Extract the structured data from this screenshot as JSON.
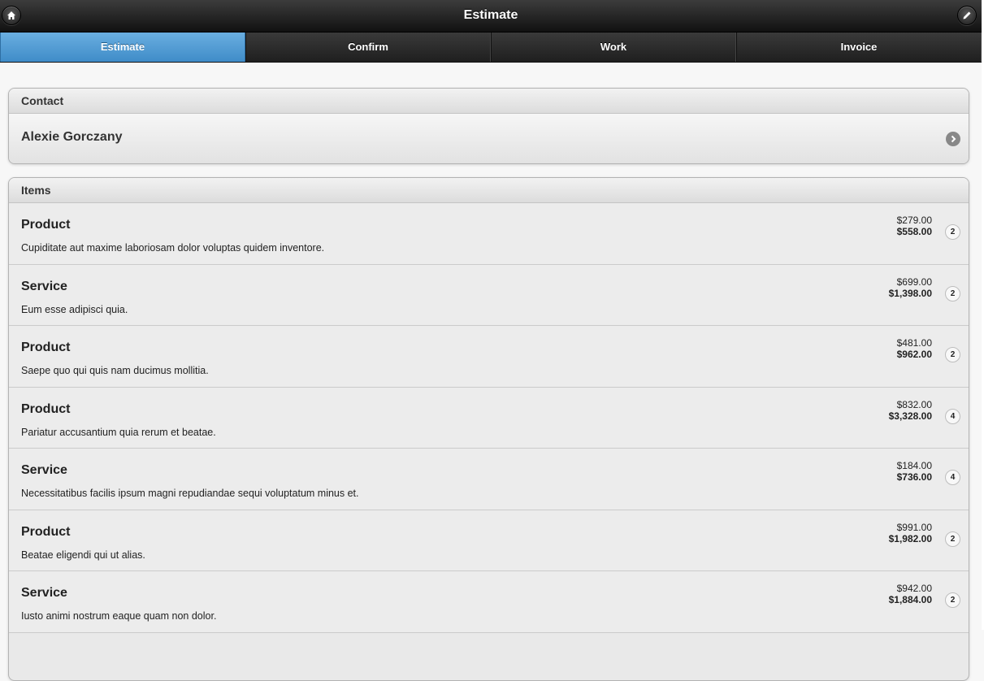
{
  "header": {
    "title": "Estimate",
    "home_icon": "home-icon",
    "edit_icon": "edit-icon"
  },
  "tabs": [
    {
      "label": "Estimate",
      "active": true
    },
    {
      "label": "Confirm",
      "active": false
    },
    {
      "label": "Work",
      "active": false
    },
    {
      "label": "Invoice",
      "active": false
    }
  ],
  "contact": {
    "heading": "Contact",
    "name": "Alexie Gorczany",
    "arrow_icon": "chevron-right-icon"
  },
  "items": {
    "heading": "Items",
    "rows": [
      {
        "title": "Product",
        "description": "Cupiditate aut maxime laboriosam dolor voluptas quidem inventore.",
        "unit_price": "$279.00",
        "total": "$558.00",
        "qty": "2"
      },
      {
        "title": "Service",
        "description": "Eum esse adipisci quia.",
        "unit_price": "$699.00",
        "total": "$1,398.00",
        "qty": "2"
      },
      {
        "title": "Product",
        "description": "Saepe quo qui quis nam ducimus mollitia.",
        "unit_price": "$481.00",
        "total": "$962.00",
        "qty": "2"
      },
      {
        "title": "Product",
        "description": "Pariatur accusantium quia rerum et beatae.",
        "unit_price": "$832.00",
        "total": "$3,328.00",
        "qty": "4"
      },
      {
        "title": "Service",
        "description": "Necessitatibus facilis ipsum magni repudiandae sequi voluptatum minus et.",
        "unit_price": "$184.00",
        "total": "$736.00",
        "qty": "4"
      },
      {
        "title": "Product",
        "description": "Beatae eligendi qui ut alias.",
        "unit_price": "$991.00",
        "total": "$1,982.00",
        "qty": "2"
      },
      {
        "title": "Service",
        "description": "Iusto animi nostrum eaque quam non dolor.",
        "unit_price": "$942.00",
        "total": "$1,884.00",
        "qty": "2"
      }
    ]
  },
  "colors": {
    "active_tab": "#4f9bd4",
    "header_bg": "#222222"
  }
}
